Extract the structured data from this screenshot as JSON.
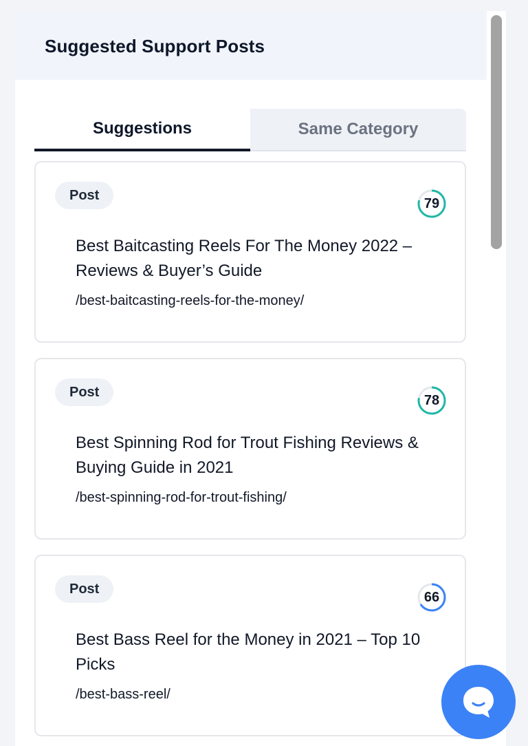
{
  "panel": {
    "title": "Suggested Support Posts"
  },
  "tabs": [
    {
      "label": "Suggestions",
      "active": true
    },
    {
      "label": "Same Category",
      "active": false
    }
  ],
  "cards": [
    {
      "badge": "Post",
      "score": "79",
      "score_fraction": 0.79,
      "score_color": "#1fb8a6",
      "title": "Best Baitcasting Reels For The Money 2022 – Reviews & Buyer’s Guide",
      "url": "/best-baitcasting-reels-for-the-money/"
    },
    {
      "badge": "Post",
      "score": "78",
      "score_fraction": 0.78,
      "score_color": "#1fb8a6",
      "title": "Best Spinning Rod for Trout Fishing Reviews & Buying Guide in 2021",
      "url": "/best-spinning-rod-for-trout-fishing/"
    },
    {
      "badge": "Post",
      "score": "66",
      "score_fraction": 0.66,
      "score_color": "#3b82f6",
      "title": "Best Bass Reel for the Money in 2021 – Top 10 Picks",
      "url": "/best-bass-reel/"
    }
  ],
  "chat": {
    "icon": "chat-bubble-icon",
    "color": "#3b82f6"
  }
}
